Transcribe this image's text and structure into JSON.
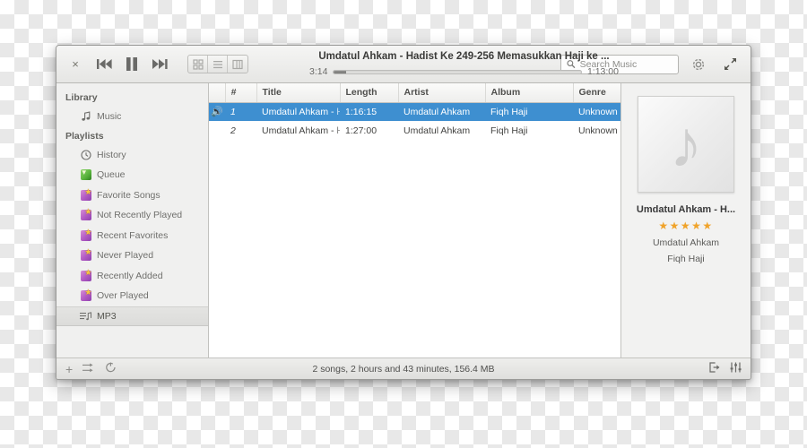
{
  "window": {
    "close_label": "×"
  },
  "toolbar": {
    "previous_label": "previous-track",
    "playpause_label": "pause",
    "next_label": "next-track",
    "views": [
      {
        "name": "grid-view",
        "label": "Grid View"
      },
      {
        "name": "list-view",
        "label": "List View"
      },
      {
        "name": "column-view",
        "label": "Column Browser View"
      }
    ],
    "settings_label": "Settings",
    "fullscreen_label": "Fullscreen"
  },
  "now_playing": {
    "title": "Umdatul Ahkam - Hadist Ke 249-256 Memasukkan Haji ke ...",
    "elapsed": "3:14",
    "total": "1:13:00",
    "progress_percent": 5
  },
  "search": {
    "placeholder": "Search Music",
    "value": ""
  },
  "sidebar": {
    "groups": [
      {
        "title": "Library",
        "items": [
          {
            "label": "Music",
            "icon": "music-note-icon",
            "selected": false
          }
        ]
      },
      {
        "title": "Playlists",
        "items": [
          {
            "label": "History",
            "icon": "history-clock-icon",
            "selected": false
          },
          {
            "label": "Queue",
            "icon": "queue-icon",
            "selected": false
          },
          {
            "label": "Favorite Songs",
            "icon": "smart-playlist-icon",
            "selected": false
          },
          {
            "label": "Not Recently Played",
            "icon": "smart-playlist-icon",
            "selected": false
          },
          {
            "label": "Recent Favorites",
            "icon": "smart-playlist-icon",
            "selected": false
          },
          {
            "label": "Never Played",
            "icon": "smart-playlist-icon",
            "selected": false
          },
          {
            "label": "Recently Added",
            "icon": "smart-playlist-icon",
            "selected": false
          },
          {
            "label": "Over Played",
            "icon": "smart-playlist-icon",
            "selected": false
          },
          {
            "label": "MP3",
            "icon": "playlist-icon",
            "selected": true
          }
        ]
      }
    ]
  },
  "tracklist": {
    "columns": [
      "",
      "#",
      "Title",
      "Length",
      "Artist",
      "Album",
      "Genre"
    ],
    "rows": [
      {
        "playing": true,
        "selected": true,
        "num": "1",
        "title": "Umdatul Ahkam - ⊢",
        "length": "1:16:15",
        "artist": "Umdatul Ahkam",
        "album": "Fiqh Haji",
        "genre": "Unknown"
      },
      {
        "playing": false,
        "selected": false,
        "num": "2",
        "title": "Umdatul Ahkam - ⊢",
        "length": "1:27:00",
        "artist": "Umdatul Ahkam",
        "album": "Fiqh Haji",
        "genre": "Unknown"
      }
    ]
  },
  "info_panel": {
    "album_art_icon": "music-note-icon",
    "title": "Umdatul Ahkam - H...",
    "stars": "★★★★★",
    "rating": 5,
    "artist": "Umdatul Ahkam",
    "album": "Fiqh Haji"
  },
  "statusbar": {
    "add_label": "+",
    "shuffle_label": "Shuffle",
    "repeat_label": "Repeat",
    "summary": "2 songs, 2 hours and 43 minutes, 156.4 MB",
    "export_label": "Export",
    "equalizer_label": "Equalizer"
  },
  "colors": {
    "selection": "#3e8fd0",
    "star": "#f0a32a",
    "window_bg": "#f2f2f1"
  }
}
